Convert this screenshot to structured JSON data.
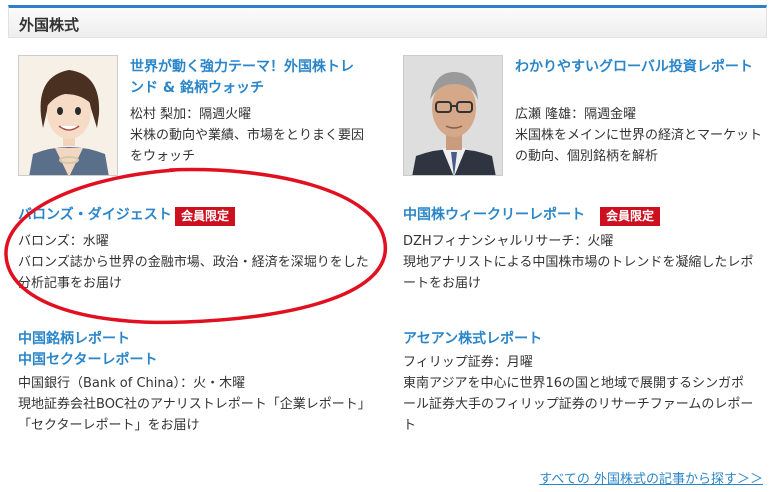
{
  "section": {
    "title": "外国株式"
  },
  "items": [
    {
      "title_lines": [
        "世界が動く強力テーマ！外国株トレ",
        "ンド & 銘柄ウォッチ"
      ],
      "author": "松村 梨加：隔週火曜",
      "desc_lines": [
        "米株の動向や業績、市場をとりまく要因",
        "をウォッチ"
      ]
    },
    {
      "title_lines": [
        "わかりやすいグローバル投資レポート"
      ],
      "author": "広瀬 隆雄：隔週金曜",
      "desc_lines": [
        "米国株をメインに世界の経済とマーケット",
        "の動向、個別銘柄を解析"
      ]
    },
    {
      "title_lines": [
        "バロンズ・ダイジェスト"
      ],
      "badge": "会員限定",
      "author": "バロンズ：水曜",
      "desc_lines": [
        "バロンズ誌から世界の金融市場、政治・経済を深堀りをした",
        "分析記事をお届け"
      ]
    },
    {
      "title_lines": [
        "中国株ウィークリーレポート"
      ],
      "badge": "会員限定",
      "author": "DZHフィナンシャルリサーチ：火曜",
      "desc_lines": [
        "現地アナリストによる中国株市場のトレンドを凝縮したレポ",
        "ートをお届け"
      ]
    },
    {
      "title_lines": [
        "中国銘柄レポート",
        "中国セクターレポート"
      ],
      "author": "中国銀行（Bank of China）：火・木曜",
      "desc_lines": [
        "現地証券会社BOC社のアナリストレポート「企業レポート」",
        "「セクターレポート」をお届け"
      ]
    },
    {
      "title_lines": [
        "アセアン株式レポート"
      ],
      "author": "フィリップ証券：月曜",
      "desc_lines": [
        "東南アジアを中心に世界16の国と地域で展開するシンガポ",
        "ール証券大手のフィリップ証券のリサーチファームのレポー",
        "ト"
      ]
    }
  ],
  "footer": {
    "link": "すべての 外国株式の記事から探す＞＞"
  },
  "colors": {
    "accent": "#2f7fc6",
    "link": "#2a86c9",
    "badge": "#cc1020",
    "annotation": "#e01020"
  },
  "icons": {
    "avatar1": "woman-illustration-portrait",
    "avatar2": "man-photo-portrait"
  }
}
